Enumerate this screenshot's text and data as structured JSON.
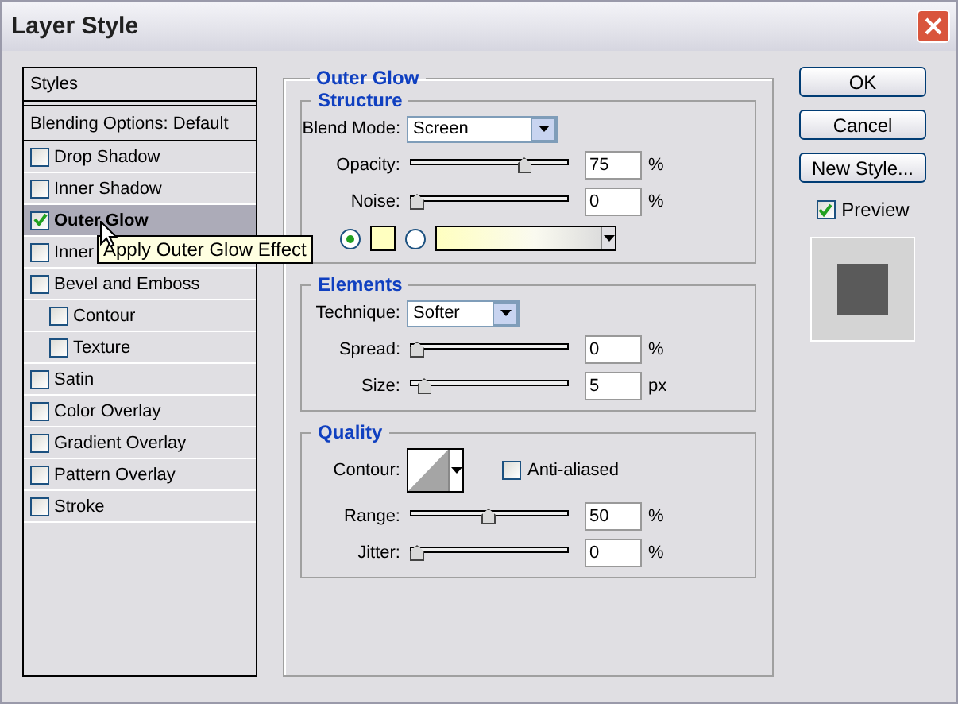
{
  "window": {
    "title": "Layer Style"
  },
  "styles_list": {
    "header": "Styles",
    "items": [
      {
        "kind": "header",
        "label": "Blending Options: Default",
        "selected": false
      },
      {
        "kind": "check",
        "label": "Drop Shadow",
        "checked": false,
        "selected": false
      },
      {
        "kind": "check",
        "label": "Inner Shadow",
        "checked": false,
        "selected": false
      },
      {
        "kind": "check",
        "label": "Outer Glow",
        "checked": true,
        "selected": true
      },
      {
        "kind": "check",
        "label": "Inner",
        "checked": false,
        "selected": false
      },
      {
        "kind": "check",
        "label": "Bevel and Emboss",
        "checked": false,
        "selected": false,
        "children": [
          {
            "kind": "check",
            "label": "Contour",
            "checked": false,
            "selected": false
          },
          {
            "kind": "check",
            "label": "Texture",
            "checked": false,
            "selected": false
          }
        ]
      },
      {
        "kind": "check",
        "label": "Satin",
        "checked": false,
        "selected": false
      },
      {
        "kind": "check",
        "label": "Color Overlay",
        "checked": false,
        "selected": false
      },
      {
        "kind": "check",
        "label": "Gradient Overlay",
        "checked": false,
        "selected": false
      },
      {
        "kind": "check",
        "label": "Pattern Overlay",
        "checked": false,
        "selected": false
      },
      {
        "kind": "check",
        "label": "Stroke",
        "checked": false,
        "selected": false
      }
    ]
  },
  "tooltip": "Apply Outer Glow Effect",
  "panel": {
    "title": "Outer Glow",
    "structure": {
      "title": "Structure",
      "blend_mode": {
        "label": "Blend Mode:",
        "value": "Screen"
      },
      "sliders": [
        {
          "label": "Opacity:",
          "level": 0.75,
          "value": "75",
          "unit": "%"
        },
        {
          "label": "Noise:",
          "level": 0,
          "value": "0",
          "unit": "%"
        }
      ],
      "color_source": [
        {
          "kind": "swatch",
          "selected": true,
          "color": "#ffffc0"
        },
        {
          "kind": "gradient",
          "selected": false,
          "color": "#ffffc0"
        }
      ]
    },
    "elements": {
      "title": "Elements",
      "technique": {
        "label": "Technique:",
        "value": "Softer"
      },
      "sliders": [
        {
          "label": "Spread:",
          "level": 0,
          "value": "0",
          "unit": "%"
        },
        {
          "label": "Size:",
          "level": 0.05,
          "value": "5",
          "unit": "px"
        }
      ]
    },
    "quality": {
      "title": "Quality",
      "contour_label": "Contour:",
      "anti_aliased": {
        "label": "Anti-aliased",
        "checked": false
      },
      "sliders": [
        {
          "label": "Range:",
          "level": 0.5,
          "value": "50",
          "unit": "%"
        },
        {
          "label": "Jitter:",
          "level": 0,
          "value": "0",
          "unit": "%"
        }
      ]
    }
  },
  "buttons": [
    "OK",
    "Cancel",
    "New Style..."
  ],
  "preview": {
    "label": "Preview",
    "checked": true
  }
}
